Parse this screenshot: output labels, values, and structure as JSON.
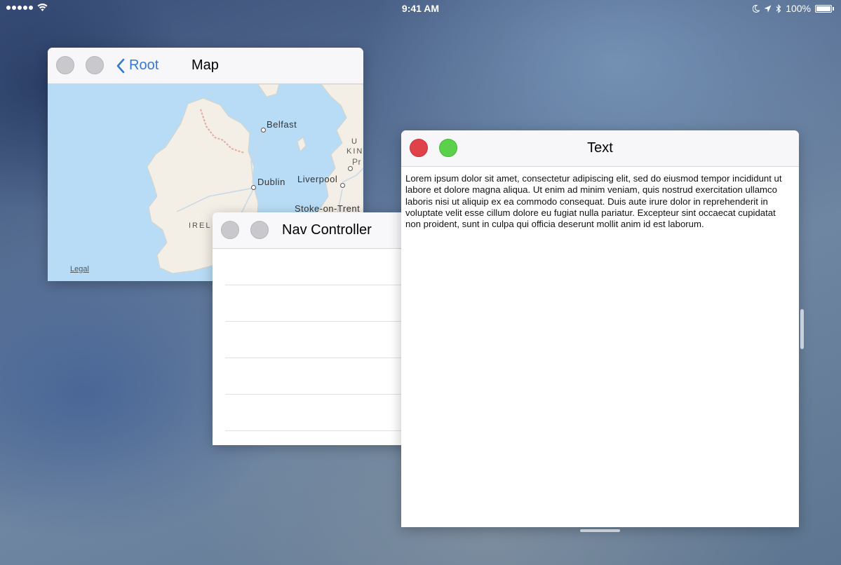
{
  "status_bar": {
    "time": "9:41 AM",
    "battery": "100%",
    "icons": [
      "signal-dots-icon",
      "wifi-icon",
      "moon-icon",
      "location-arrow-icon",
      "bluetooth-icon",
      "battery-icon"
    ]
  },
  "map_window": {
    "title": "Map",
    "back_label": "Root",
    "legal": "Legal",
    "places": {
      "belfast": "Belfast",
      "dublin": "Dublin",
      "liverpool": "Liverpool",
      "stoke": "Stoke-on-Trent",
      "ireland": "IREL",
      "uk_1": "U",
      "uk_2": "KIN",
      "preston": "Pr"
    }
  },
  "nav_window": {
    "title": "Nav Controller",
    "rows": [
      "",
      "",
      "",
      "",
      ""
    ]
  },
  "text_window": {
    "title": "Text",
    "body": "Lorem ipsum dolor sit amet, consectetur adipiscing elit, sed do eiusmod tempor incididunt ut labore et dolore magna aliqua. Ut enim ad minim veniam, quis nostrud exercitation ullamco laboris nisi ut aliquip ex ea commodo consequat. Duis aute irure dolor in reprehenderit in voluptate velit esse cillum dolore eu fugiat nulla pariatur. Excepteur sint occaecat cupidatat non proident, sunt in culpa qui officia deserunt mollit anim id est laborum."
  },
  "colors": {
    "close": "#e0424a",
    "zoom": "#5bd04a",
    "inactive": "#c9c8cc",
    "link": "#3478d4",
    "water": "#b8dcf5",
    "land": "#f3efe6"
  }
}
